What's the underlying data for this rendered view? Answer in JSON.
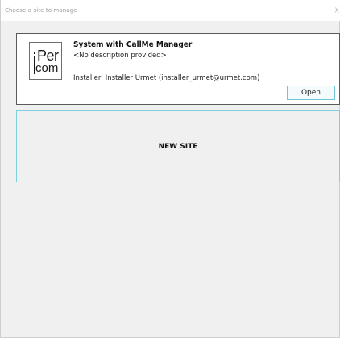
{
  "window": {
    "title": "Choose a site to manage",
    "close_glyph": "X"
  },
  "site": {
    "logo_text_top": "Per",
    "logo_text_bottom": "com",
    "name": "System with CallMe Manager",
    "description": "<No description provided>",
    "installer": "Installer: Installer Urmet (installer_urmet@urmet.com)",
    "open_label": "Open"
  },
  "new_site": {
    "label": "NEW SITE"
  },
  "colors": {
    "accent_border": "#7fd0df",
    "window_bg": "#f0f0f0"
  },
  "icons": {
    "close": "close-icon",
    "logo": "ipercom-logo"
  }
}
